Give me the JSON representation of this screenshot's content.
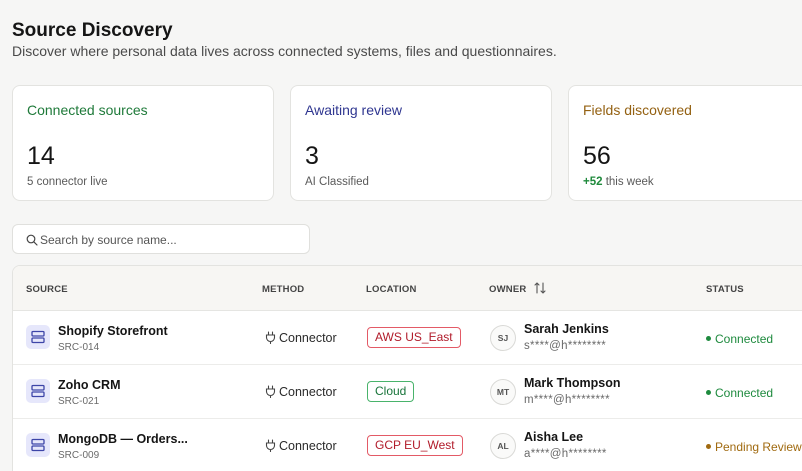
{
  "header": {
    "title": "Source Discovery",
    "subtitle": "Discover where personal data lives across connected systems, files and questionnaires."
  },
  "cards": [
    {
      "title": "Connected sources",
      "value": "14",
      "note": "5 connector live",
      "color": "#1f7a3a"
    },
    {
      "title": "Awaiting review",
      "value": "3",
      "note": "AI Classified",
      "color": "#2f3690"
    },
    {
      "title": "Fields discovered",
      "value": "56",
      "delta": "+52",
      "note": "this week",
      "color": "#946112"
    }
  ],
  "search": {
    "placeholder": "Search by source name..."
  },
  "table": {
    "headers": {
      "source": "SOURCE",
      "method": "METHOD",
      "location": "LOCATION",
      "owner": "OWNER",
      "status": "STATUS"
    },
    "rows": [
      {
        "name": "Shopify Storefront",
        "id": "SRC-014",
        "method": "Connector",
        "location": "AWS US_East",
        "location_color": "red",
        "initials": "SJ",
        "owner": "Sarah Jenkins",
        "email": "s****@h********",
        "status": "Connected",
        "status_color": "green"
      },
      {
        "name": "Zoho CRM",
        "id": "SRC-021",
        "method": "Connector",
        "location": "Cloud",
        "location_color": "green",
        "initials": "MT",
        "owner": "Mark Thompson",
        "email": "m****@h********",
        "status": "Connected",
        "status_color": "green"
      },
      {
        "name": "MongoDB — Orders...",
        "id": "SRC-009",
        "method": "Connector",
        "location": "GCP EU_West",
        "location_color": "red",
        "initials": "AL",
        "owner": "Aisha Lee",
        "email": "a****@h********",
        "status": "Pending Review",
        "status_color": "amber"
      }
    ]
  },
  "icons": {
    "search": "search-icon",
    "source": "server-icon",
    "method": "plug-icon",
    "sort": "sort-icon"
  }
}
